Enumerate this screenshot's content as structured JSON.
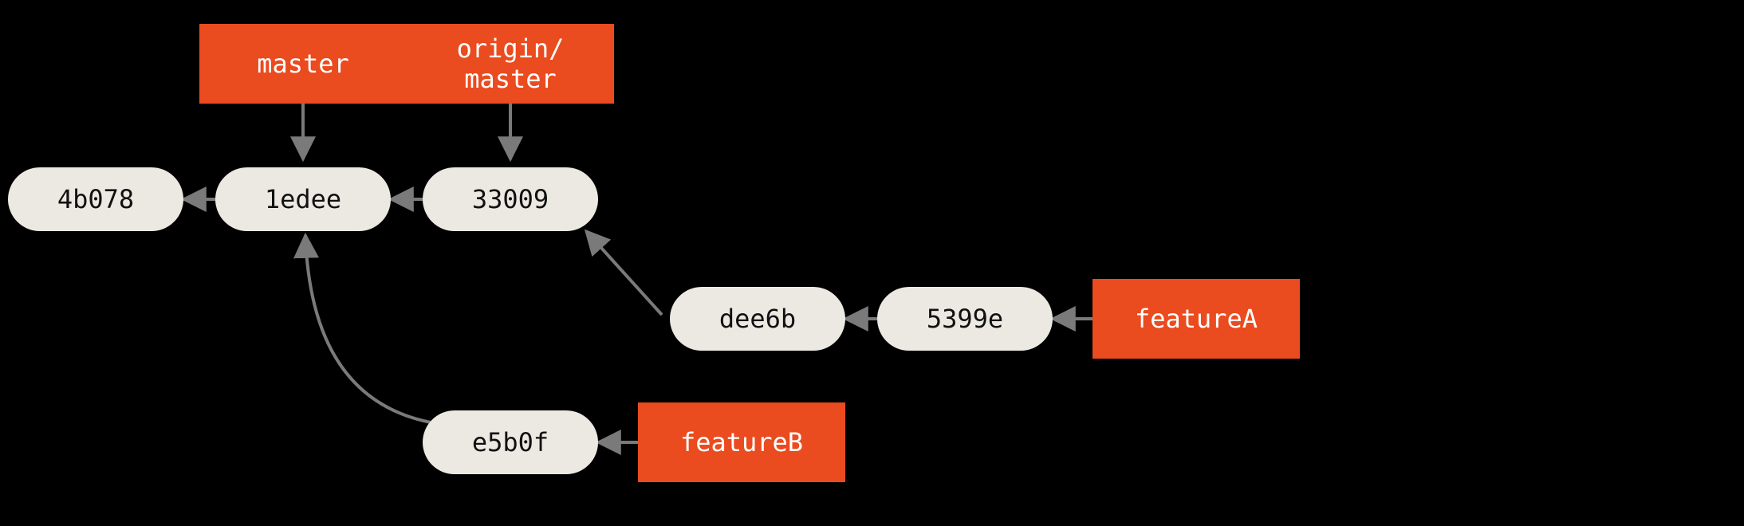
{
  "commits": {
    "c1": "4b078",
    "c2": "1edee",
    "c3": "33009",
    "c4": "dee6b",
    "c5": "5399e",
    "c6": "e5b0f"
  },
  "branches": {
    "master": "master",
    "origin_master": "origin/\nmaster",
    "featureA": "featureA",
    "featureB": "featureB"
  },
  "graph": {
    "edges": [
      {
        "from": "1edee",
        "to": "4b078"
      },
      {
        "from": "33009",
        "to": "1edee"
      },
      {
        "from": "dee6b",
        "to": "33009"
      },
      {
        "from": "5399e",
        "to": "dee6b"
      },
      {
        "from": "e5b0f",
        "to": "1edee"
      }
    ],
    "refs": [
      {
        "ref": "master",
        "commit": "1edee"
      },
      {
        "ref": "origin/master",
        "commit": "33009"
      },
      {
        "ref": "featureA",
        "commit": "5399e"
      },
      {
        "ref": "featureB",
        "commit": "e5b0f"
      }
    ]
  }
}
